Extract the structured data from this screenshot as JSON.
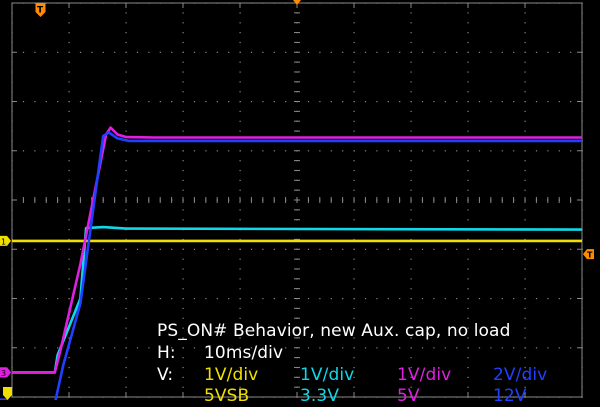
{
  "screen": {
    "background": "#000000",
    "grid_color": "#8a8a8a",
    "trigger_color": "#ff8c00",
    "trigger_marker": "T"
  },
  "annotation": {
    "title": "PS_ON# Behavior, new Aux. cap, no load",
    "h_label": "H:",
    "h_value": "10ms/div",
    "v_label": "V:"
  },
  "chart_data": {
    "type": "line",
    "title": "PS_ON# Behavior, new Aux. cap, no load",
    "x_unit": "ms",
    "time_per_division": "10ms/div",
    "divisions": {
      "horizontal": 10,
      "vertical": 8
    },
    "xlim": [
      0,
      100
    ],
    "grid": true,
    "series": [
      {
        "name": "5VSB",
        "channel": "1",
        "scale": "1V/div",
        "color": "#f0e000",
        "x": [
          0,
          100
        ],
        "div": [
          3.17,
          3.17
        ]
      },
      {
        "name": "3.3V",
        "channel": "2",
        "scale": "1V/div",
        "color": "#10d8e8",
        "x": [
          0,
          7.5,
          8.0,
          12.0,
          13.0,
          16.0,
          20.0,
          100
        ],
        "div": [
          0.5,
          0.5,
          0.85,
          2.0,
          3.43,
          3.45,
          3.42,
          3.4
        ]
      },
      {
        "name": "5V",
        "channel": "3",
        "scale": "1V/div",
        "color": "#e020e0",
        "x": [
          0,
          7.5,
          8.5,
          12.0,
          16.5,
          17.3,
          18.5,
          20.0,
          25.0,
          100
        ],
        "div": [
          0.5,
          0.5,
          0.95,
          2.7,
          5.33,
          5.47,
          5.33,
          5.28,
          5.27,
          5.27
        ]
      },
      {
        "name": "12V",
        "channel": "4",
        "scale": "2V/div",
        "color": "#2040ff",
        "x": [
          0,
          7.5,
          9.0,
          12.0,
          16.0,
          17.0,
          18.5,
          20.5,
          100
        ],
        "div": [
          -0.13,
          -0.13,
          0.65,
          1.9,
          5.3,
          5.37,
          5.25,
          5.2,
          5.2
        ]
      }
    ]
  }
}
